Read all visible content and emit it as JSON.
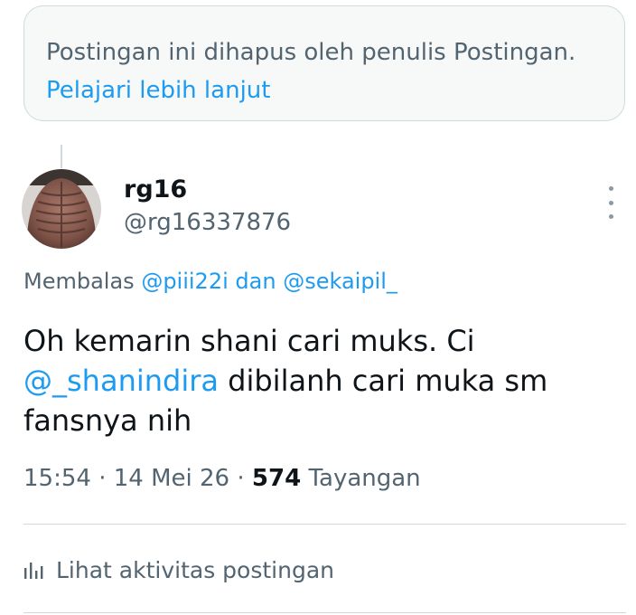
{
  "deleted_notice": {
    "text": "Postingan ini dihapus oleh penulis Postingan.",
    "link_label": "Pelajari lebih lanjut",
    "link_color": "#1d9bf0"
  },
  "tweet": {
    "display_name": "rg16",
    "handle": "@rg16337876",
    "reply_prefix": "Membalas",
    "reply_mention_1": "@piii22i",
    "reply_conjunction": "dan",
    "reply_mention_2": "@sekaipil_",
    "text_before": "Oh kemarin shani cari muks. Ci",
    "text_mention": "@_shanindira",
    "text_after": "dibilanh cari muka sm fansnya nih",
    "time": "15:54",
    "separator": "·",
    "date": "14 Mei 26",
    "views_count": "574",
    "views_label": "Tayangan"
  },
  "activity": {
    "icon": "analytics-bar-icon",
    "label": "Lihat aktivitas postingan"
  },
  "colors": {
    "accent": "#1d9bf0",
    "text_primary": "#0f1419",
    "text_secondary": "#536471",
    "border": "#cfd9de"
  }
}
